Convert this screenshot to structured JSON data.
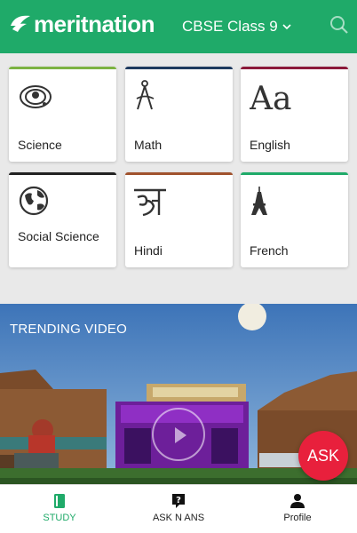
{
  "header": {
    "logo_text": "meritnation",
    "class_select": "CBSE Class 9",
    "colors": {
      "brand": "#1faa69"
    }
  },
  "subjects": [
    {
      "label": "Science",
      "icon": "atom-icon",
      "color": "#7cb342"
    },
    {
      "label": "Math",
      "icon": "compass-icon",
      "color": "#1e3a5f"
    },
    {
      "label": "English",
      "icon": "text-aa-icon",
      "color": "#8b1a3a"
    },
    {
      "label": "Social Science",
      "icon": "globe-icon",
      "color": "#222222"
    },
    {
      "label": "Hindi",
      "icon": "hindi-letter-icon",
      "color": "#a0522d"
    },
    {
      "label": "French",
      "icon": "eiffel-tower-icon",
      "color": "#1faa69"
    }
  ],
  "video": {
    "title": "TRENDING VIDEO"
  },
  "fab": {
    "label": "ASK",
    "color": "#e8203c"
  },
  "bottom_nav": [
    {
      "label": "STUDY",
      "icon": "book-icon",
      "active": true
    },
    {
      "label": "ASK N ANS",
      "icon": "question-bubble-icon",
      "active": false
    },
    {
      "label": "Profile",
      "icon": "person-icon",
      "active": false
    }
  ]
}
